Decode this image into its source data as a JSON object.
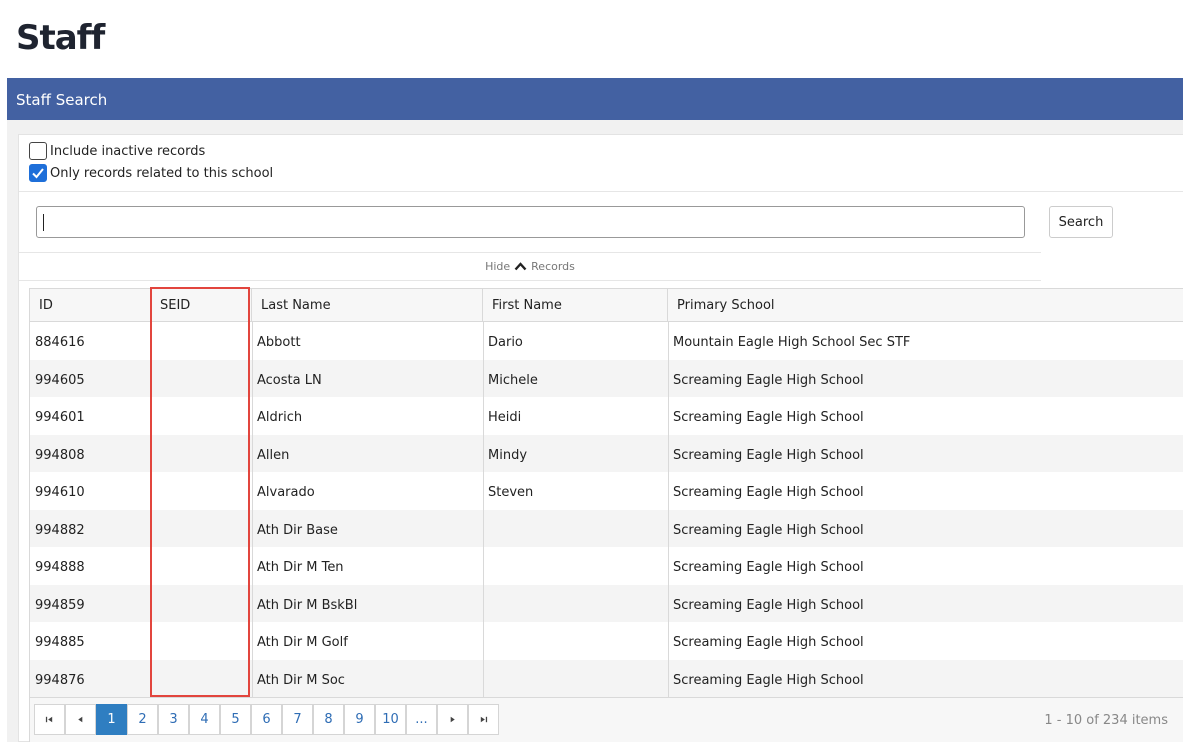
{
  "page": {
    "title": "Staff"
  },
  "panel": {
    "header": "Staff Search"
  },
  "filters": {
    "include_inactive": {
      "label": "Include inactive records",
      "checked": false
    },
    "only_school": {
      "label": "Only records related to this school",
      "checked": true
    }
  },
  "search": {
    "value": "",
    "button_label": "Search"
  },
  "toggle": {
    "hide_label": "Hide",
    "records_label": "Records"
  },
  "table": {
    "columns": [
      "ID",
      "SEID",
      "Last Name",
      "First Name",
      "Primary School"
    ],
    "rows": [
      {
        "id": "884616",
        "seid": "",
        "last": "Abbott",
        "first": "Dario",
        "school": "Mountain Eagle High School Sec STF"
      },
      {
        "id": "994605",
        "seid": "",
        "last": "Acosta LN",
        "first": "Michele",
        "school": "Screaming Eagle High School"
      },
      {
        "id": "994601",
        "seid": "",
        "last": "Aldrich",
        "first": "Heidi",
        "school": "Screaming Eagle High School"
      },
      {
        "id": "994808",
        "seid": "",
        "last": "Allen",
        "first": "Mindy",
        "school": "Screaming Eagle High School"
      },
      {
        "id": "994610",
        "seid": "",
        "last": "Alvarado",
        "first": "Steven",
        "school": "Screaming Eagle High School"
      },
      {
        "id": "994882",
        "seid": "",
        "last": "Ath Dir Base",
        "first": "",
        "school": "Screaming Eagle High School"
      },
      {
        "id": "994888",
        "seid": "",
        "last": "Ath Dir M Ten",
        "first": "",
        "school": "Screaming Eagle High School"
      },
      {
        "id": "994859",
        "seid": "",
        "last": "Ath Dir M BskBl",
        "first": "",
        "school": "Screaming Eagle High School"
      },
      {
        "id": "994885",
        "seid": "",
        "last": "Ath Dir M Golf",
        "first": "",
        "school": "Screaming Eagle High School"
      },
      {
        "id": "994876",
        "seid": "",
        "last": "Ath Dir M Soc",
        "first": "",
        "school": "Screaming Eagle High School"
      }
    ]
  },
  "pager": {
    "first_icon": "first-page-icon",
    "prev_icon": "prev-page-icon",
    "next_icon": "next-page-icon",
    "last_icon": "last-page-icon",
    "pages": [
      "1",
      "2",
      "3",
      "4",
      "5",
      "6",
      "7",
      "8",
      "9",
      "10",
      "..."
    ],
    "current": "1",
    "info": "1 - 10 of 234 items"
  },
  "colors": {
    "header_bg": "#4361a2",
    "accent": "#2f7ec1",
    "highlight": "#e2453d"
  }
}
